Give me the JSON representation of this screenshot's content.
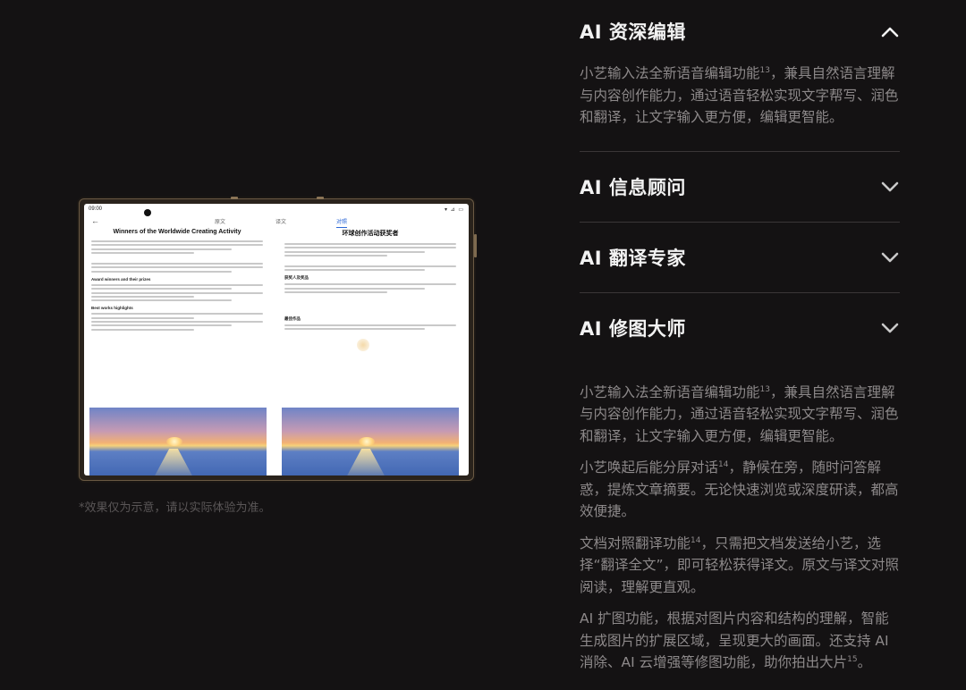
{
  "device": {
    "status_time": "09:00",
    "status_icons": "▾ ⊿ ▭",
    "tabs": [
      "原文",
      "译文",
      "对照"
    ],
    "active_tab": "对照",
    "left_doc_title": "Winners of the Worldwide Creating Activity",
    "left_headings": [
      "Award winners and their prizes",
      "Best works highlights"
    ],
    "right_doc_title": "环球创作活动获奖者",
    "right_headings": [
      "获奖人及奖品",
      "最佳作品"
    ]
  },
  "caption": "*效果仅为示意，请以实际体验为准。",
  "accordion": [
    {
      "title": "AI 资深编辑",
      "expanded": true,
      "paragraphs": [
        {
          "text": "小艺输入法全新语音编辑功能",
          "sup": "13",
          "tail": "，兼具自然语言理解与内容创作能力，通过语音轻松实现文字帮写、润色和翻译，让文字输入更方便，编辑更智能。"
        }
      ]
    },
    {
      "title": "AI 信息顾问",
      "expanded": false
    },
    {
      "title": "AI 翻译专家",
      "expanded": false
    },
    {
      "title": "AI 修图大师",
      "expanded": false,
      "paragraphs": [
        {
          "text": "小艺输入法全新语音编辑功能",
          "sup": "13",
          "tail": "，兼具自然语言理解与内容创作能力，通过语音轻松实现文字帮写、润色和翻译，让文字输入更方便，编辑更智能。"
        },
        {
          "text": "小艺唤起后能分屏对话",
          "sup": "14",
          "tail": "，静候在旁，随时问答解惑，提炼文章摘要。无论快速浏览或深度研读，都高效便捷。"
        },
        {
          "text": "文档对照翻译功能",
          "sup": "14",
          "tail": "，只需把文档发送给小艺，选择“翻译全文”，即可轻松获得译文。原文与译文对照阅读，理解更直观。"
        },
        {
          "text": "AI 扩图功能，根据对图片内容和结构的理解，智能生成图片的扩展区域，呈现更大的画面。还支持 AI 消除、AI 云增强等修图功能，助你拍出大片",
          "sup": "15",
          "tail": "。"
        }
      ]
    }
  ],
  "colors": {
    "background": "#141213",
    "heading": "#f2f2f2",
    "body_text": "#8d898a",
    "divider": "#3a3637",
    "accent_tab": "#2b67d6"
  },
  "icons": {
    "expanded": "chevron-up-icon",
    "collapsed": "chevron-down-icon"
  }
}
